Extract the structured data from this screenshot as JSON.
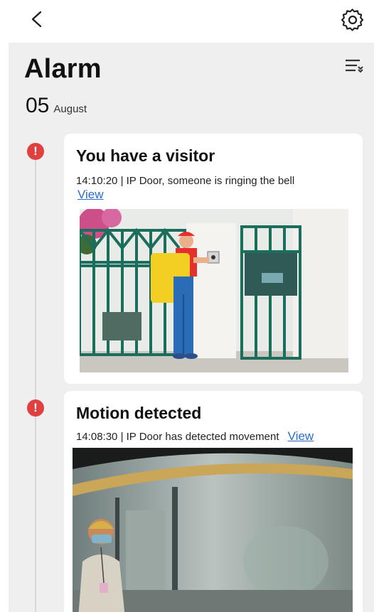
{
  "header": {
    "back_icon": "back-chevron-icon",
    "settings_icon": "gear-icon"
  },
  "page": {
    "title": "Alarm",
    "filter_icon": "filter-list-icon"
  },
  "date": {
    "day": "05",
    "month": "August"
  },
  "events": [
    {
      "title": "You have a visitor",
      "time": "14:10:20",
      "separator": "|",
      "description": "IP Door, someone is ringing the bell",
      "view_label": "View",
      "icon": "alert-icon"
    },
    {
      "title": "Motion detected",
      "time": "14:08:30",
      "separator": "|",
      "description": "IP Door has detected movement",
      "view_label": "View",
      "icon": "alert-icon"
    }
  ],
  "colors": {
    "alert": "#e04040",
    "link": "#2a6cc9",
    "panel": "#efefef",
    "gate": "#1c6e5c"
  }
}
